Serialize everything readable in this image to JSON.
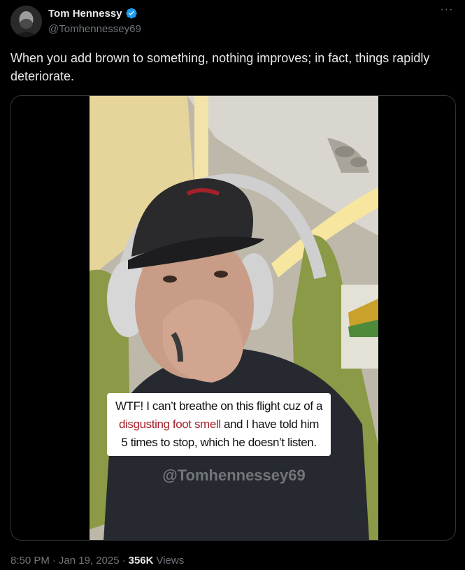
{
  "author": {
    "display_name": "Tom Hennessy",
    "handle": "@Tomhennessey69"
  },
  "tweet": {
    "text": "When you add brown to something, nothing improves; in fact, things rapidly deteriorate."
  },
  "media": {
    "caption_part1": "WTF! I can’t breathe on this flight cuz of a",
    "caption_highlight": "disgusting foot smell",
    "caption_part2": " and I have told him",
    "caption_part3": "5 times to stop, which he doesn’t listen.",
    "watermark": "@Tomhennessey69"
  },
  "footer": {
    "time": "8:50 PM",
    "separator": "·",
    "date": "Jan 19, 2025",
    "views_count": "356K",
    "views_label": "Views"
  },
  "icons": {
    "verified": "verified-badge-icon",
    "more": "more-icon"
  },
  "colors": {
    "background": "#000000",
    "text": "#e7e9ea",
    "muted": "#71767b",
    "verified": "#1d9bf0",
    "caption_highlight": "#a3202a"
  }
}
